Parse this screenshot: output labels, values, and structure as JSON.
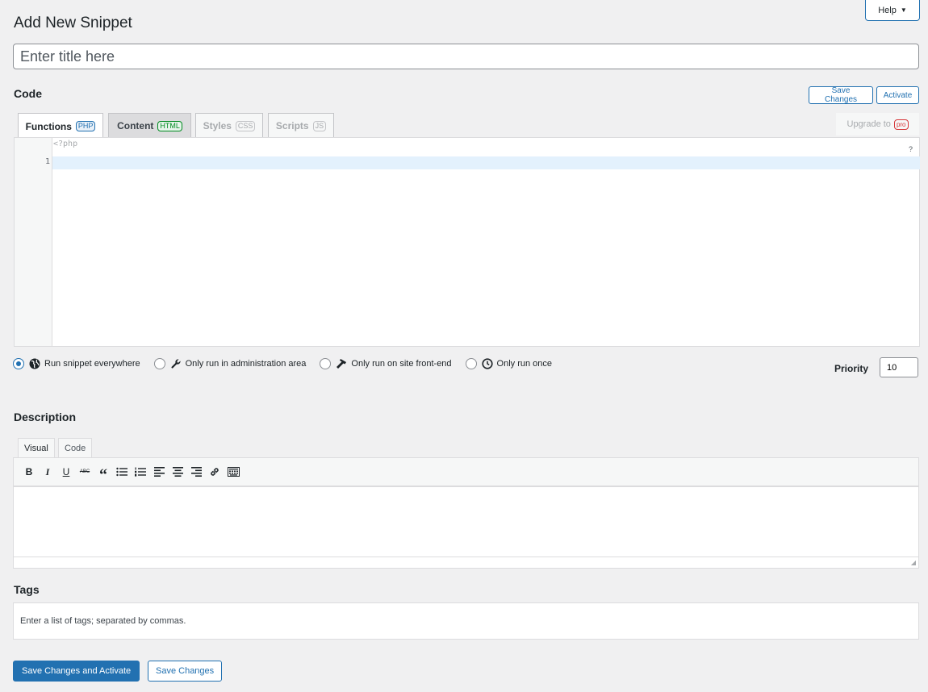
{
  "help": {
    "label": "Help",
    "caret": "▼"
  },
  "page": {
    "title": "Add New Snippet"
  },
  "title_field": {
    "placeholder": "Enter title here",
    "value": ""
  },
  "code": {
    "heading": "Code",
    "save_label": "Save Changes",
    "activate_label": "Activate",
    "tabs": [
      {
        "label": "Functions",
        "badge": "PHP"
      },
      {
        "label": "Content",
        "badge": "HTML"
      },
      {
        "label": "Styles",
        "badge": "CSS"
      },
      {
        "label": "Scripts",
        "badge": "JS"
      }
    ],
    "upgrade": {
      "label": "Upgrade to",
      "badge": "pro"
    },
    "editor": {
      "php_open_tag": "<?php",
      "line_number": "1",
      "help_mark": "?"
    }
  },
  "scope": {
    "options": [
      {
        "label": "Run snippet everywhere",
        "icon": "globe-icon",
        "checked": true
      },
      {
        "label": "Only run in administration area",
        "icon": "wrench-icon",
        "checked": false
      },
      {
        "label": "Only run on site front-end",
        "icon": "hammer-icon",
        "checked": false
      },
      {
        "label": "Only run once",
        "icon": "clock-icon",
        "checked": false
      }
    ]
  },
  "priority": {
    "label": "Priority",
    "value": "10"
  },
  "description": {
    "heading": "Description",
    "tabs": [
      {
        "label": "Visual"
      },
      {
        "label": "Code"
      }
    ],
    "toolbar": [
      {
        "name": "bold-icon",
        "glyph": "B"
      },
      {
        "name": "italic-icon",
        "glyph": "I"
      },
      {
        "name": "underline-icon",
        "glyph": "U"
      },
      {
        "name": "strikethrough-icon",
        "glyph": "ABC"
      },
      {
        "name": "blockquote-icon",
        "glyph": "“"
      },
      {
        "name": "bulleted-list-icon",
        "glyph": ""
      },
      {
        "name": "numbered-list-icon",
        "glyph": ""
      },
      {
        "name": "align-left-icon",
        "glyph": ""
      },
      {
        "name": "align-center-icon",
        "glyph": ""
      },
      {
        "name": "align-right-icon",
        "glyph": ""
      },
      {
        "name": "link-icon",
        "glyph": ""
      },
      {
        "name": "toolbar-toggle-icon",
        "glyph": ""
      }
    ]
  },
  "tags": {
    "heading": "Tags",
    "placeholder": "Enter a list of tags; separated by commas."
  },
  "footer": {
    "save_activate_label": "Save Changes and Activate",
    "save_label": "Save Changes"
  },
  "colors": {
    "accent": "#2271b1",
    "background": "#f0f0f1",
    "pro": "#d63638",
    "html_badge": "#008a20"
  }
}
